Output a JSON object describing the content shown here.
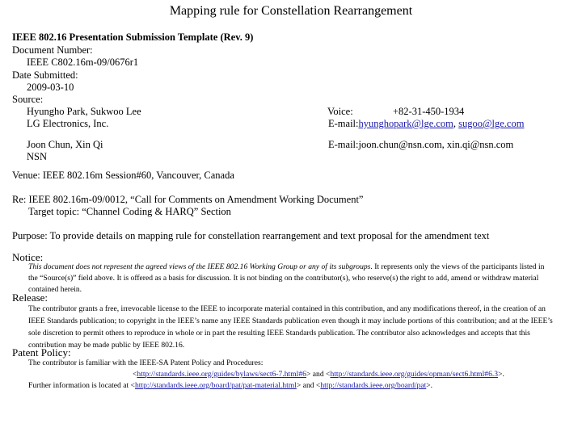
{
  "title": "Mapping rule for Constellation Rearrangement",
  "template_heading": "IEEE 802.16 Presentation Submission Template (Rev. 9)",
  "document_number": {
    "label": "Document Number:",
    "value": "IEEE C802.16m-09/0676r1"
  },
  "date_submitted": {
    "label": "Date Submitted:",
    "value": "2009-03-10"
  },
  "source": {
    "label": "Source:",
    "authors": [
      {
        "names": "Hyungho Park, Sukwoo Lee",
        "org": "LG Electronics, Inc.",
        "voice_label": "Voice:",
        "voice": "+82-31-450-1934",
        "email_label": "E-mail:",
        "emails": [
          "hyunghopark@lge.com",
          "sugoo@lge.com"
        ]
      },
      {
        "names": "Joon Chun, Xin Qi",
        "org": "NSN",
        "email_label": "E-mail:",
        "email_text": "joon.chun@nsn.com, xin.qi@nsn.com"
      }
    ]
  },
  "venue": "Venue: IEEE 802.16m Session#60, Vancouver, Canada",
  "re": {
    "line1": "Re: IEEE 802.16m-09/0012, “Call for Comments on Amendment Working Document”",
    "line2": "Target topic: “Channel Coding & HARQ” Section"
  },
  "purpose": "Purpose: To provide details on mapping rule for constellation rearrangement and text proposal for the amendment text",
  "notice": {
    "label": "Notice:",
    "italic": "This document does not represent the agreed views of the IEEE 802.16 Working Group or any of its subgroups",
    "line1_rest": ". It represents only the views of the participants listed in",
    "line2": "the “Source(s)” field above. It is offered as a basis for discussion. It is not binding on the contributor(s), who reserve(s) the right to add, amend or withdraw material",
    "line3": "contained herein."
  },
  "release": {
    "label": "Release:",
    "lines": [
      "The contributor grants a free, irrevocable license to the IEEE to incorporate material contained in this contribution, and any modifications thereof, in the creation of an",
      "IEEE Standards publication; to copyright in the IEEE’s name any IEEE Standards publication even though it may include portions of this contribution; and at the IEEE’s",
      "sole discretion to permit others to reproduce in whole or in part the resulting IEEE Standards publication. The contributor also acknowledges and accepts that this",
      "contribution may be made public by IEEE 802.16."
    ]
  },
  "patent": {
    "label": "Patent Policy:",
    "line1": "The contributor is familiar with the IEEE-SA Patent Policy and Procedures:",
    "link1": "http://standards.ieee.org/guides/bylaws/sect6-7.html#6",
    "and": "> and <",
    "link2": "http://standards.ieee.org/guides/opman/sect6.html#6.3",
    "end": ">.",
    "further": "Further information is located at <",
    "link3": "http://standards.ieee.org/board/pat/pat-material.html",
    "link4": "http://standards.ieee.org/board/pat",
    "lt": "<"
  }
}
